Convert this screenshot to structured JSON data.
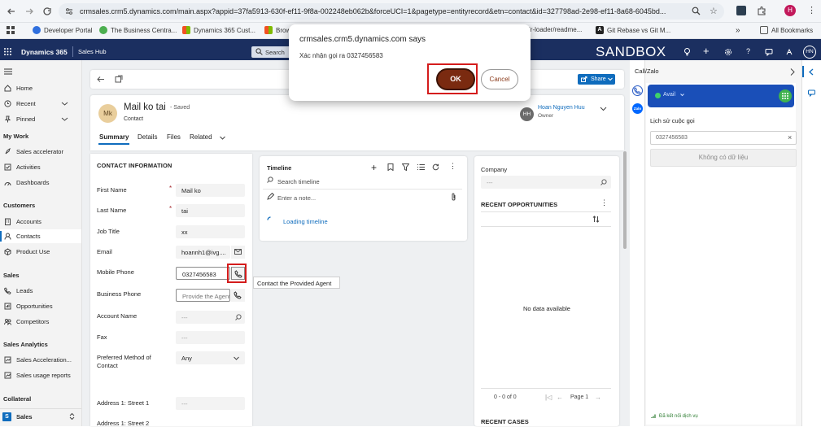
{
  "browser": {
    "url": "crmsales.crm5.dynamics.com/main.aspx?appid=37fa5913-630f-ef11-9f8a-002248eb062b&forceUCI=1&pagetype=entityrecord&etn=contact&id=327798ad-2e98-ef11-8a68-6045bd...",
    "profile_initial": "H",
    "bookmarks": [
      "Developer Portal",
      "The Business Centra...",
      "Dynamics 365 Cust...",
      "Brow",
      "ir-loader/readme...",
      "Git Rebase vs Git M...",
      "All Bookmarks"
    ],
    "more_chevron": "»"
  },
  "appbar": {
    "app_name": "Dynamics 365",
    "area": "Sales Hub",
    "search_label": "Search",
    "sandbox": "SANDBOX",
    "user_initials": "HN"
  },
  "sidebar": {
    "items_top": [
      "Home",
      "Recent",
      "Pinned"
    ],
    "my_work_header": "My Work",
    "my_work": [
      "Sales accelerator",
      "Activities",
      "Dashboards"
    ],
    "customers_header": "Customers",
    "customers": [
      "Accounts",
      "Contacts",
      "Product Use"
    ],
    "sales_header": "Sales",
    "sales": [
      "Leads",
      "Opportunities",
      "Competitors"
    ],
    "analytics_header": "Sales Analytics",
    "analytics": [
      "Sales Acceleration...",
      "Sales usage reports"
    ],
    "collateral_header": "Collateral",
    "area_switch_letter": "S",
    "area_switch_label": "Sales"
  },
  "record": {
    "avatar": "Mk",
    "title": "Mail ko tai",
    "saved": "- Saved",
    "entity": "Contact",
    "owner_initials": "HH",
    "owner_name": "Hoan Nguyen Huu",
    "owner_label": "Owner",
    "share": "Share",
    "tabs": [
      "Summary",
      "Details",
      "Files",
      "Related"
    ]
  },
  "contact": {
    "section_title": "CONTACT INFORMATION",
    "first_name_label": "First Name",
    "first_name": "Mail ko",
    "last_name_label": "Last Name",
    "last_name": "tai",
    "job_title_label": "Job Title",
    "job_title": "xx",
    "email_label": "Email",
    "email": "hoannh1@ivg....",
    "mobile_label": "Mobile Phone",
    "mobile": "0327456583",
    "business_label": "Business Phone",
    "business_placeholder": "Provide the Agent",
    "account_label": "Account Name",
    "account": "---",
    "fax_label": "Fax",
    "fax": "---",
    "pref_label": "Preferred Method of Contact",
    "pref": "Any",
    "street1_label": "Address 1: Street 1",
    "street1": "---",
    "street2_label": "Address 1: Street 2",
    "tooltip": "Contact the Provided Agent"
  },
  "timeline": {
    "title": "Timeline",
    "search": "Search timeline",
    "note": "Enter a note...",
    "loading": "Loading timeline"
  },
  "company": {
    "label": "Company",
    "value": "---",
    "opps_title": "RECENT OPPORTUNITIES",
    "no_data": "No data available",
    "pager_count": "0 - 0 of 0",
    "pager_page": "Page 1",
    "cases_title": "RECENT CASES"
  },
  "callpanel": {
    "title": "Call/Zalo",
    "status": "Avail",
    "history_label": "Lịch sử cuộc gọi",
    "search_value": "0327456583",
    "no_data": "Không có dữ liệu",
    "connected": "Đã kết nối dịch vụ"
  },
  "dialog": {
    "title": "crmsales.crm5.dynamics.com says",
    "message": "Xác nhận gọi ra 0327456583",
    "ok": "OK",
    "cancel": "Cancel"
  },
  "colors": {
    "appbar": "#1b2f60",
    "ok_button": "#7a2a10",
    "callpanel_status": "#1a4fb8",
    "highlight": "#d41c1c",
    "link": "#0f6cbd"
  }
}
